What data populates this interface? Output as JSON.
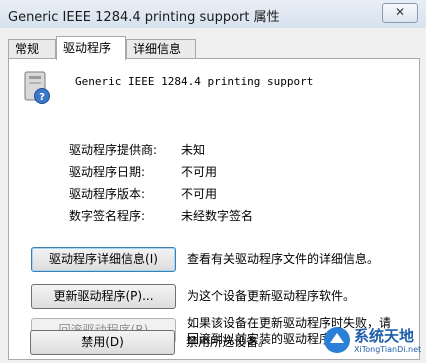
{
  "window": {
    "title": "Generic IEEE 1284.4 printing support 属性",
    "close_label": "✕"
  },
  "tabs": [
    {
      "label": "常规"
    },
    {
      "label": "驱动程序"
    },
    {
      "label": "详细信息"
    }
  ],
  "device": {
    "name": "Generic IEEE 1284.4 printing support"
  },
  "properties": [
    {
      "label": "驱动程序提供商:",
      "value": "未知"
    },
    {
      "label": "驱动程序日期:",
      "value": "不可用"
    },
    {
      "label": "驱动程序版本:",
      "value": "不可用"
    },
    {
      "label": "数字签名程序:",
      "value": "未经数字签名"
    }
  ],
  "buttons": [
    {
      "label": "驱动程序详细信息(I)",
      "desc": "查看有关驱动程序文件的详细信息。"
    },
    {
      "label": "更新驱动程序(P)...",
      "desc": "为这个设备更新驱动程序软件。"
    },
    {
      "label": "回滚驱动程序(R)",
      "desc": "如果该设备在更新驱动程序时失败，请回滚到以前安装的驱动程序。"
    },
    {
      "label": "禁用(D)",
      "desc": "禁用所选设备。"
    }
  ],
  "desc_lines": {
    "rollback_line1": "如果该设备在更新驱动程序时失败，请",
    "rollback_line2": "回滚到以前安装的驱动程序。"
  },
  "watermark": {
    "text": "系统天地",
    "url": "XiTongTianDi.net"
  }
}
